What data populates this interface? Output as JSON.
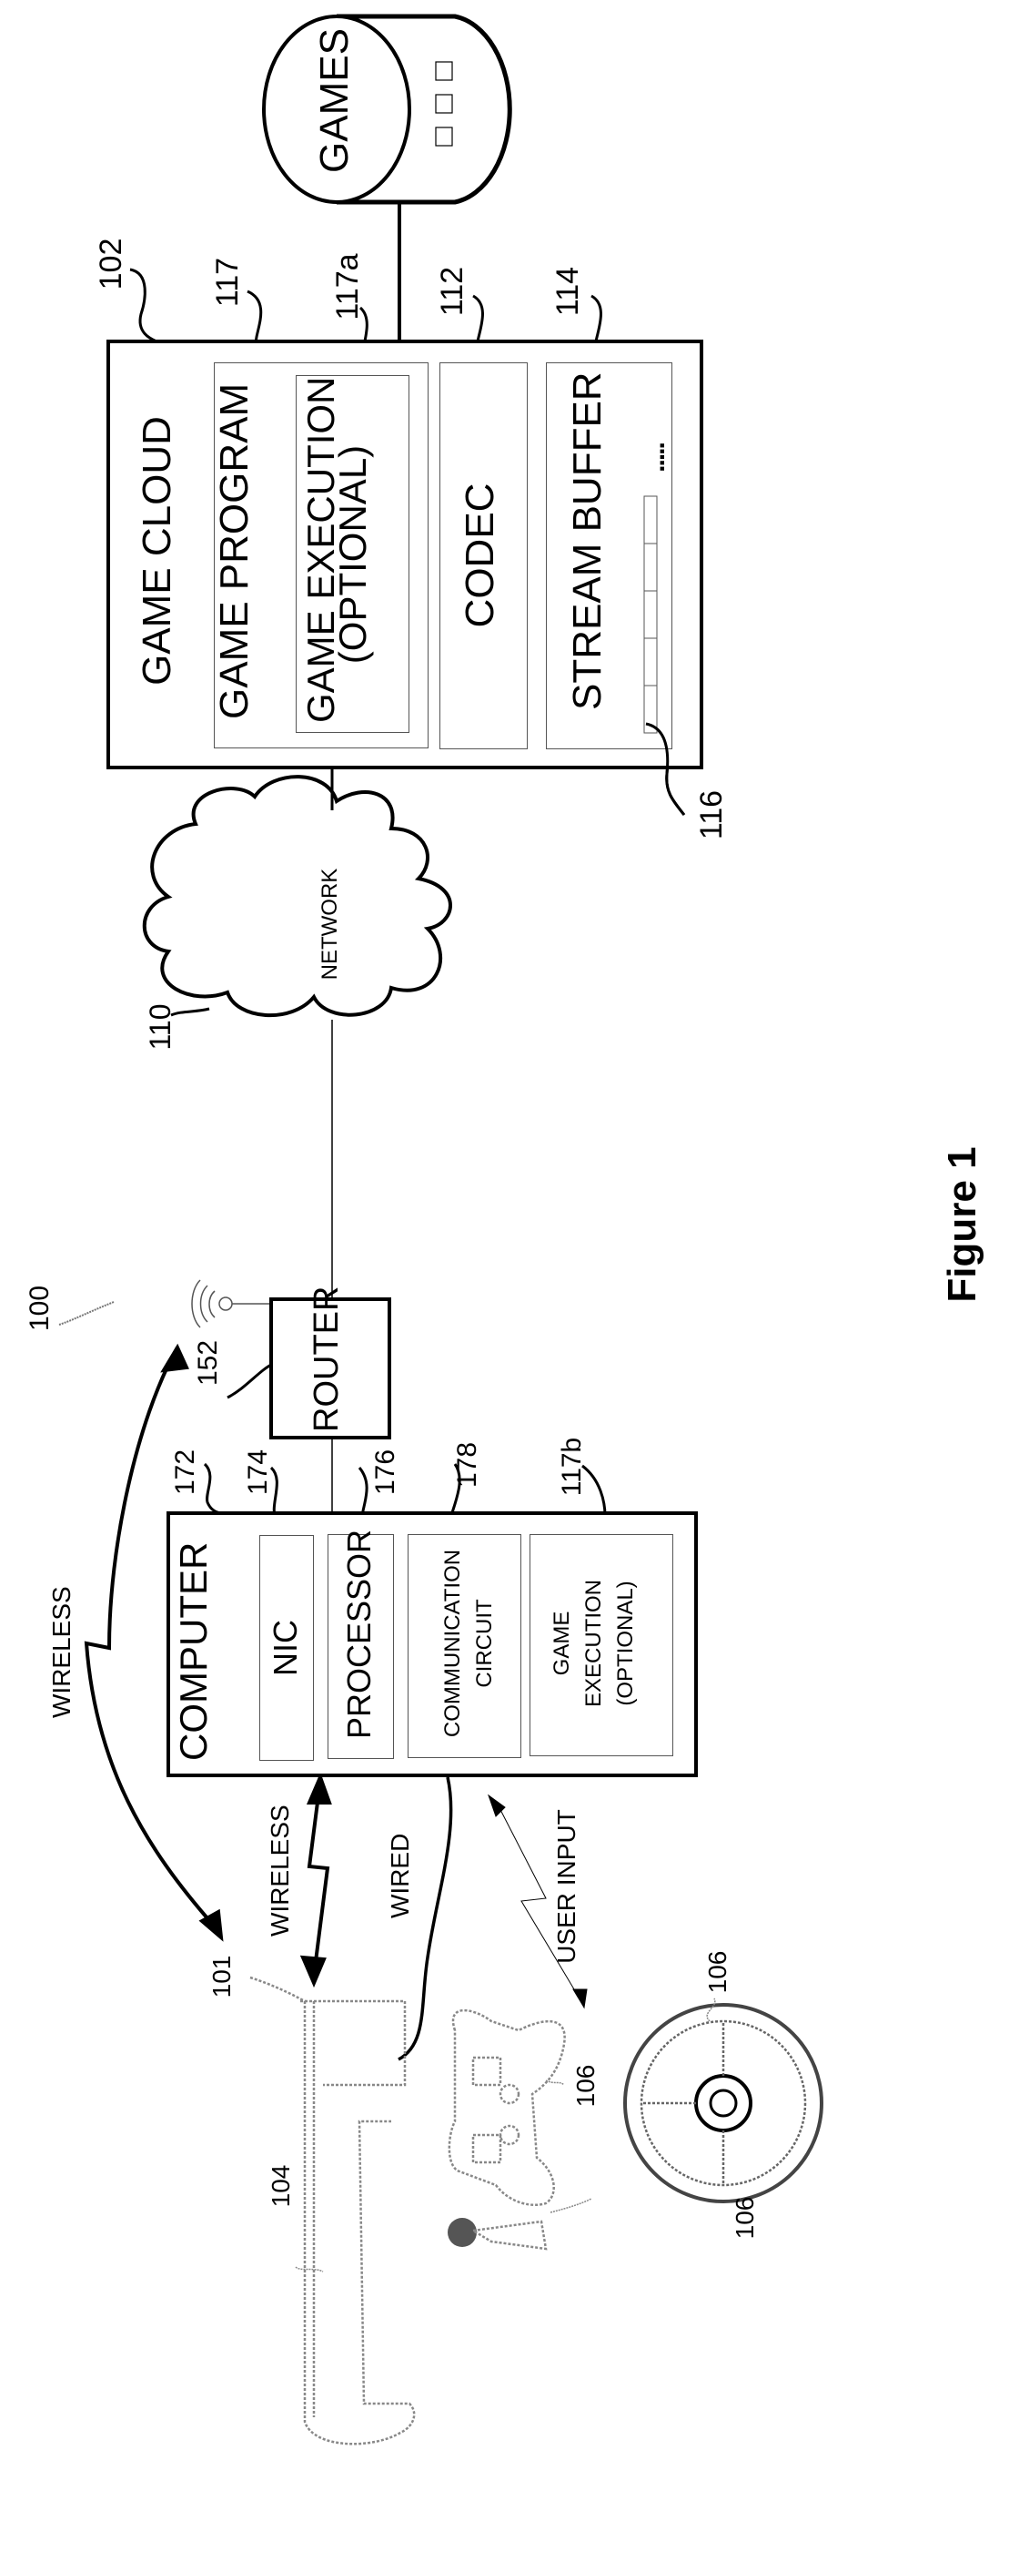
{
  "figure": {
    "title": "Figure 1",
    "system_ref": "100"
  },
  "games_db": {
    "label": "GAMES",
    "slots": 3
  },
  "game_cloud": {
    "ref": "102",
    "label": "GAME CLOUD",
    "game_program": {
      "ref": "117",
      "label": "GAME PROGRAM"
    },
    "game_execution": {
      "ref": "117a",
      "line1": "GAME EXECUTION",
      "line2": "(OPTIONAL)"
    },
    "codec": {
      "ref": "112",
      "label": "CODEC"
    },
    "stream_buffer": {
      "ref": "114",
      "label": "STREAM BUFFER",
      "frame_ref": "116",
      "ellipsis": "....."
    }
  },
  "network": {
    "ref": "110",
    "label": "NETWORK"
  },
  "router": {
    "ref": "152",
    "label": "ROUTER"
  },
  "computer": {
    "ref": "172",
    "label": "COMPUTER",
    "nic": {
      "ref": "174",
      "label": "NIC"
    },
    "processor": {
      "ref": "176",
      "label": "PROCESSOR"
    },
    "comm_circuit": {
      "ref": "178",
      "line1": "COMMUNICATION",
      "line2": "CIRCUIT"
    },
    "game_execution": {
      "ref": "117b",
      "line1": "GAME",
      "line2": "EXECUTION",
      "line3": "(OPTIONAL)"
    }
  },
  "links": {
    "wireless_router": "WIRELESS",
    "wireless_computer": "WIRELESS",
    "wired": "WIRED",
    "user_input": "USER INPUT"
  },
  "devices": {
    "hmd": {
      "ref": "101"
    },
    "user": {
      "ref": "104"
    },
    "controller": {
      "ref": "106"
    },
    "wheel": {
      "ref": "106"
    },
    "mic": {
      "ref": "106"
    }
  }
}
